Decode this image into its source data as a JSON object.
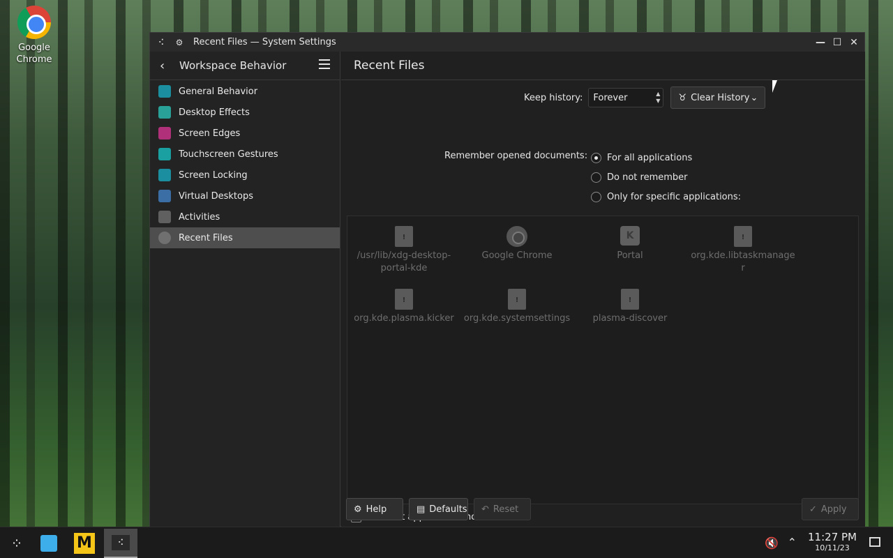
{
  "desktop": {
    "icons": [
      {
        "label_line1": "Google",
        "label_line2": "Chrome"
      }
    ]
  },
  "window": {
    "title": "Recent Files — System Settings",
    "controls": {
      "minimize": "—",
      "maximize": "☐",
      "close": "✕"
    }
  },
  "sidebar": {
    "title": "Workspace Behavior",
    "items": [
      {
        "label": "General Behavior",
        "icon": "general-behavior-icon",
        "color": "#1b8fa0"
      },
      {
        "label": "Desktop Effects",
        "icon": "desktop-effects-icon",
        "color": "#2aa198"
      },
      {
        "label": "Screen Edges",
        "icon": "screen-edges-icon",
        "color": "#b0307a"
      },
      {
        "label": "Touchscreen Gestures",
        "icon": "touchscreen-gestures-icon",
        "color": "#1aa0a0"
      },
      {
        "label": "Screen Locking",
        "icon": "screen-locking-icon",
        "color": "#1b8fa0"
      },
      {
        "label": "Virtual Desktops",
        "icon": "virtual-desktops-icon",
        "color": "#3a6ea5"
      },
      {
        "label": "Activities",
        "icon": "activities-icon",
        "color": "#606060"
      },
      {
        "label": "Recent Files",
        "icon": "clock-icon",
        "color": "#707070"
      }
    ],
    "active_index": 7
  },
  "main": {
    "title": "Recent Files",
    "keep_history": {
      "label": "Keep history:",
      "value": "Forever"
    },
    "clear_history": {
      "label": "Clear History"
    },
    "remember": {
      "label": "Remember opened documents:",
      "options": [
        "For all applications",
        "Do not remember",
        "Only for specific applications:"
      ],
      "selected_index": 0
    },
    "apps": [
      {
        "line1": "/usr/lib/xdg-desktop-",
        "line2": "portal-kde",
        "icon": "document-icon"
      },
      {
        "line1": "Google Chrome",
        "line2": "",
        "icon": "chrome-icon"
      },
      {
        "line1": "Portal",
        "line2": "",
        "icon": "kde-icon"
      },
      {
        "line1": "org.kde.libtaskmanage",
        "line2": "r",
        "icon": "document-icon"
      },
      {
        "line1": "org.kde.plasma.kicker",
        "line2": "",
        "icon": "document-icon"
      },
      {
        "line1": "org.kde.systemsettings",
        "line2": "",
        "icon": "document-icon"
      },
      {
        "line1": "plasma-discover",
        "line2": "",
        "icon": "document-icon"
      }
    ],
    "blacklist": {
      "label": "Blacklist applications not on the list",
      "checked": false
    },
    "buttons": {
      "help": "Help",
      "defaults": "Defaults",
      "reset": "Reset",
      "apply": "Apply"
    }
  },
  "taskbar": {
    "clock_time": "11:27 PM",
    "clock_date": "10/11/23"
  }
}
